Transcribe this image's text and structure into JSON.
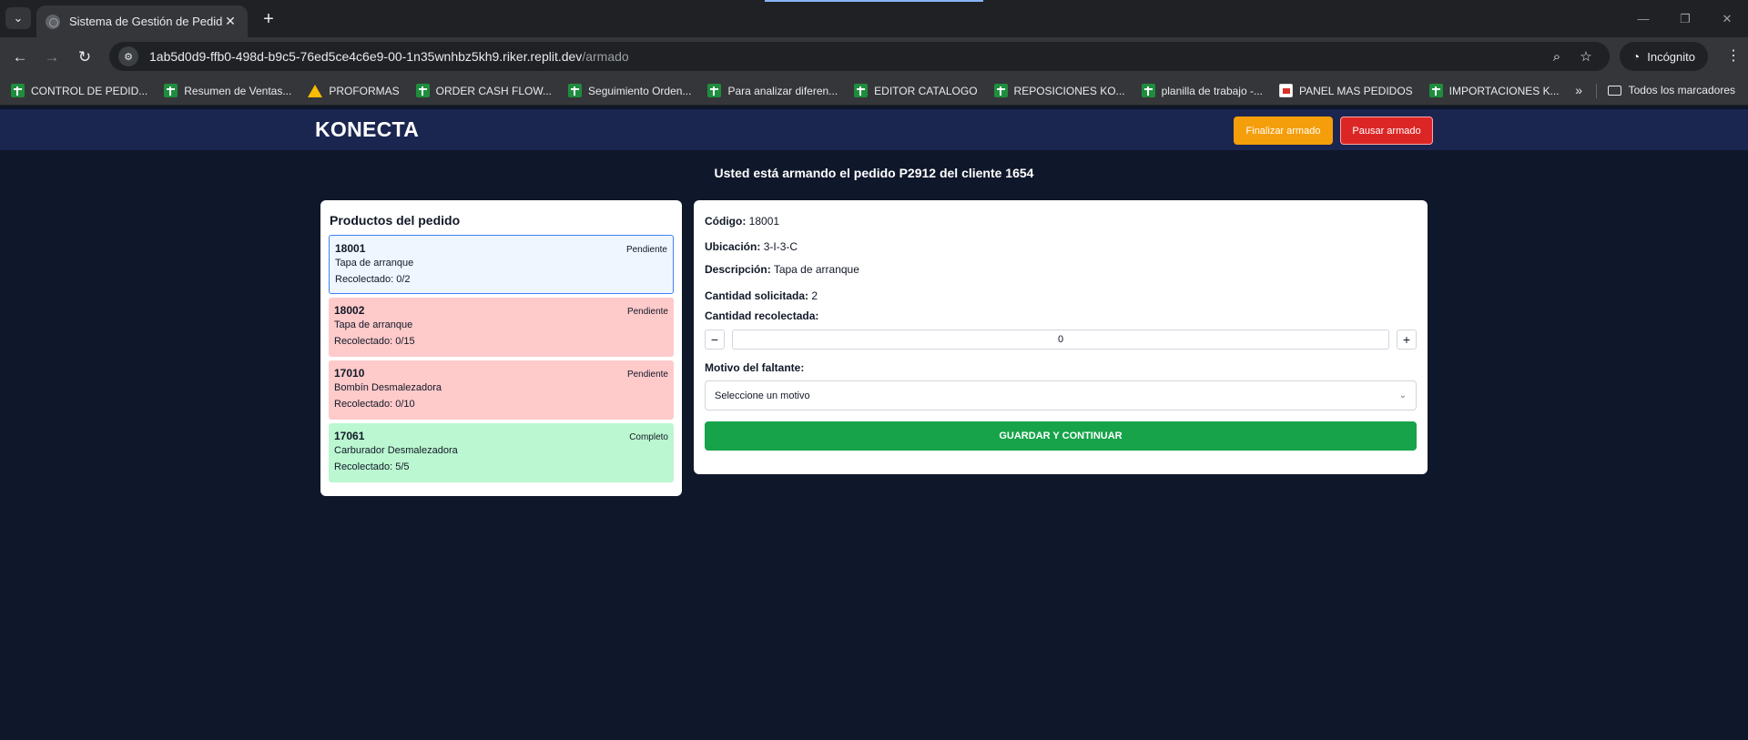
{
  "browser": {
    "tab_title": "Sistema de Gestión de Pedidos",
    "url_host": "1ab5d0d9-ffb0-498d-b9c5-76ed5ce4c6e9-00-1n35wnhbz5kh9.riker.replit.dev",
    "url_path": "/armado",
    "incognito_label": "Incógnito",
    "bookmarks": [
      {
        "label": "CONTROL DE PEDID...",
        "icon": "sheets-icon"
      },
      {
        "label": "Resumen de Ventas...",
        "icon": "sheets-icon"
      },
      {
        "label": "PROFORMAS",
        "icon": "drive-icon"
      },
      {
        "label": "ORDER CASH FLOW...",
        "icon": "sheets-icon"
      },
      {
        "label": "Seguimiento Orden...",
        "icon": "sheets-icon"
      },
      {
        "label": "Para analizar diferen...",
        "icon": "sheets-icon"
      },
      {
        "label": "EDITOR CATALOGO",
        "icon": "sheets-icon"
      },
      {
        "label": "REPOSICIONES KO...",
        "icon": "sheets-icon"
      },
      {
        "label": "planilla de trabajo -...",
        "icon": "sheets-icon"
      },
      {
        "label": "PANEL MAS PEDIDOS",
        "icon": "panel-icon"
      },
      {
        "label": "IMPORTACIONES K...",
        "icon": "sheets-icon"
      }
    ],
    "all_bookmarks_label": "Todos los marcadores"
  },
  "app": {
    "brand": "KONECTA",
    "finalize_label": "Finalizar armado",
    "pause_label": "Pausar armado",
    "order_message": "Usted está armando el pedido P2912 del cliente 1654",
    "colors": {
      "header": "#1a2550",
      "background": "#0f172a",
      "finalize": "#f59e0b",
      "pause": "#dc2626",
      "save": "#16a34a"
    }
  },
  "products": {
    "title": "Productos del pedido",
    "items": [
      {
        "code": "18001",
        "desc": "Tapa de arranque",
        "collected": "Recolectado: 0/2",
        "status": "Pendiente"
      },
      {
        "code": "18002",
        "desc": "Tapa de arranque",
        "collected": "Recolectado: 0/15",
        "status": "Pendiente"
      },
      {
        "code": "17010",
        "desc": "Bombín Desmalezadora",
        "collected": "Recolectado: 0/10",
        "status": "Pendiente"
      },
      {
        "code": "17061",
        "desc": "Carburador Desmalezadora",
        "collected": "Recolectado: 5/5",
        "status": "Completo"
      }
    ]
  },
  "detail": {
    "code_label": "Código:",
    "code_value": "18001",
    "location_label": "Ubicación:",
    "location_value": "3-I-3-C",
    "description_label": "Descripción:",
    "description_value": "Tapa de arranque",
    "requested_label": "Cantidad solicitada:",
    "requested_value": "2",
    "collected_label": "Cantidad recolectada:",
    "collected_value": "0",
    "minus": "−",
    "plus": "+",
    "reason_label": "Motivo del faltante:",
    "reason_placeholder": "Seleccione un motivo",
    "save_label": "GUARDAR Y CONTINUAR"
  }
}
